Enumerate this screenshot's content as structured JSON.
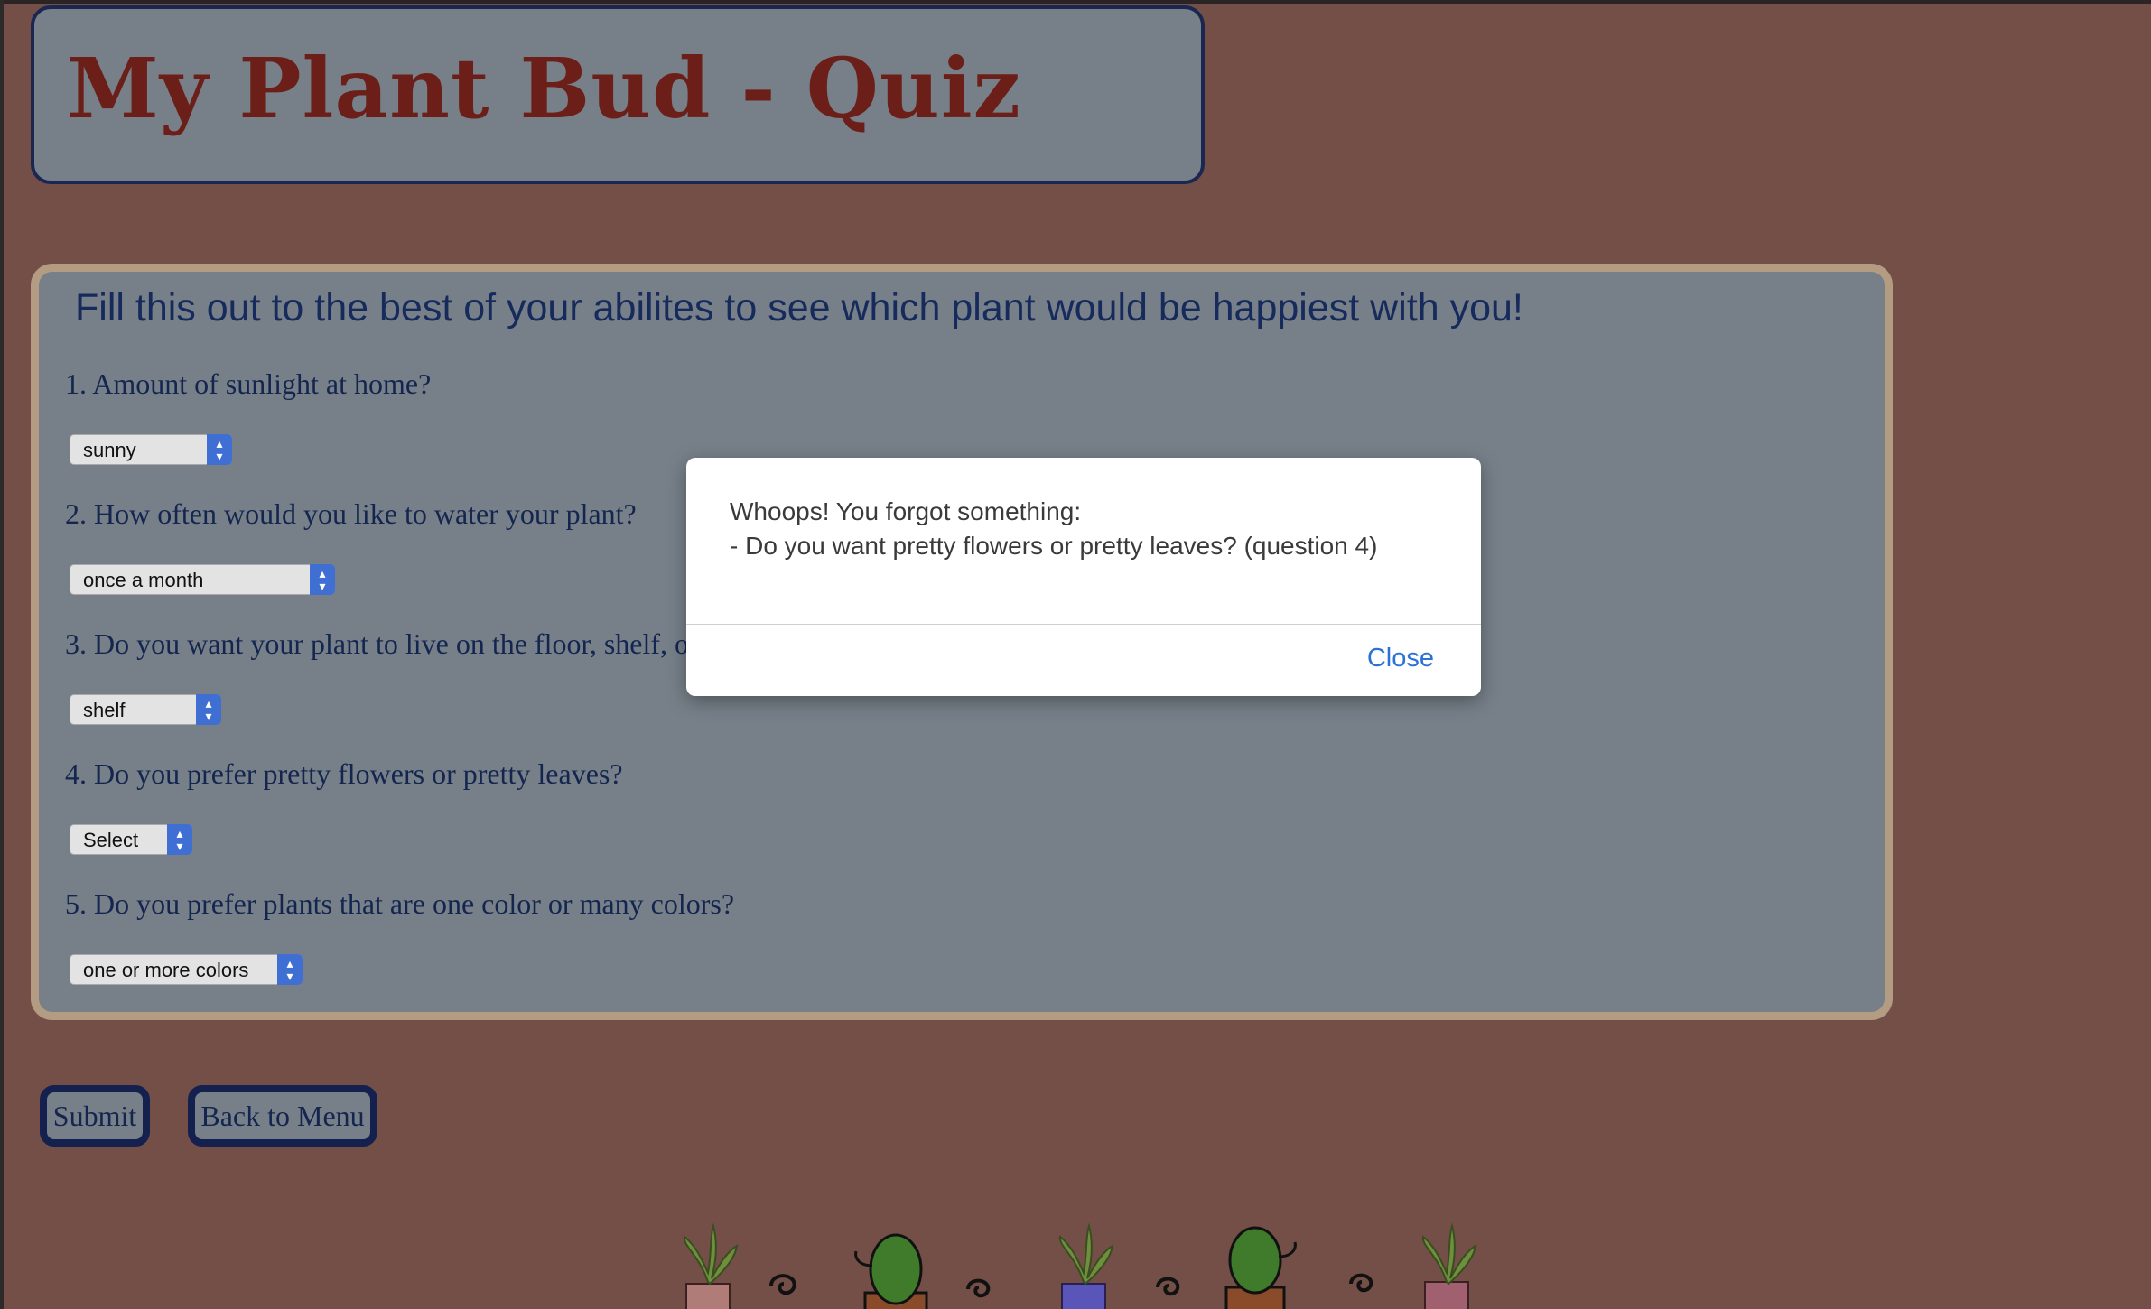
{
  "header": {
    "title": "My Plant Bud - Quiz"
  },
  "quiz": {
    "intro": "Fill this out to the best of your abilites to see which plant would be happiest with you!",
    "questions": [
      {
        "label": "1. Amount of sunlight at home?",
        "selected": "sunny"
      },
      {
        "label": "2. How often would you like to water your plant?",
        "selected": "once a month"
      },
      {
        "label": "3. Do you want your plant to live on the floor, shelf, or",
        "selected": "shelf"
      },
      {
        "label": "4. Do you prefer pretty flowers or pretty leaves?",
        "selected": "Select"
      },
      {
        "label": "5. Do you prefer plants that are one color or many colors?",
        "selected": "one or more colors"
      }
    ]
  },
  "buttons": {
    "submit": "Submit",
    "back": "Back to Menu"
  },
  "dialog": {
    "line1": "Whoops! You forgot something:",
    "line2": "- Do you want pretty flowers or pretty leaves? (question 4)",
    "close": "Close"
  },
  "decor": {
    "items": [
      "succulent-icon",
      "swirl-icon",
      "cactus-pot-icon",
      "swirl-icon",
      "succulent-icon",
      "swirl-icon",
      "cactus-pot-icon",
      "swirl-icon",
      "succulent-icon"
    ]
  },
  "colors": {
    "background": "#734f48",
    "panel": "#778089",
    "panel_border": "#b39c82",
    "title_text": "#6b1f18",
    "text_navy": "#14264f",
    "select_arrow": "#3f6fd3",
    "link_blue": "#2b72d6"
  }
}
